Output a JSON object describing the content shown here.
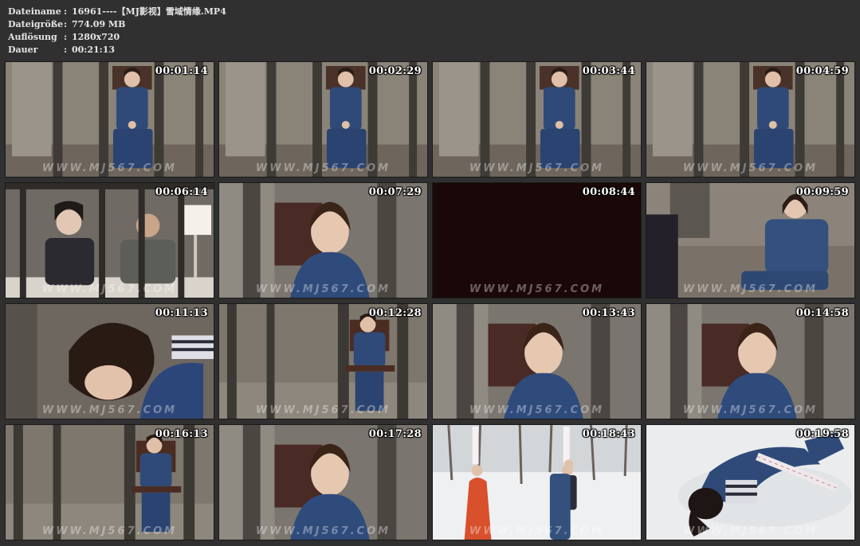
{
  "meta": {
    "rows": [
      {
        "key": "Dateiname",
        "value": "16961----【MJ影视】雪域情缘.MP4"
      },
      {
        "key": "Dateigröße",
        "value": "774.09 MB"
      },
      {
        "key": "Auflösung",
        "value": "1280x720"
      },
      {
        "key": "Dauer",
        "value": "00:21:13"
      }
    ],
    "separator": ":"
  },
  "watermark": "WWW.MJ567.COM",
  "thumbnails": [
    {
      "time": "00:01:14",
      "scene": "cell"
    },
    {
      "time": "00:02:29",
      "scene": "cell"
    },
    {
      "time": "00:03:44",
      "scene": "cell"
    },
    {
      "time": "00:04:59",
      "scene": "cell"
    },
    {
      "time": "00:06:14",
      "scene": "office"
    },
    {
      "time": "00:07:29",
      "scene": "closeup"
    },
    {
      "time": "00:08:44",
      "scene": "black"
    },
    {
      "time": "00:09:59",
      "scene": "talk"
    },
    {
      "time": "00:11:13",
      "scene": "cry"
    },
    {
      "time": "00:12:28",
      "scene": "chair"
    },
    {
      "time": "00:13:43",
      "scene": "closeup"
    },
    {
      "time": "00:14:58",
      "scene": "closeup"
    },
    {
      "time": "00:16:13",
      "scene": "chair"
    },
    {
      "time": "00:17:28",
      "scene": "closeup"
    },
    {
      "time": "00:18:43",
      "scene": "snow"
    },
    {
      "time": "00:19:58",
      "scene": "snowground"
    }
  ]
}
